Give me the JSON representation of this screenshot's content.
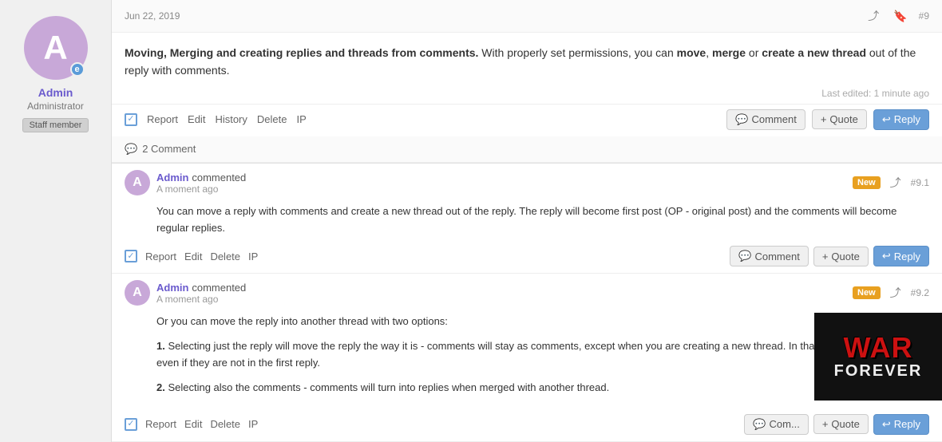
{
  "sidebar": {
    "avatar_letter": "A",
    "avatar_badge": "e",
    "username": "Admin",
    "role": "Administrator",
    "staff_label": "Staff member"
  },
  "post": {
    "date": "Jun 22, 2019",
    "post_number": "#9",
    "body_bold": "Moving, Merging and creating replies and threads from comments.",
    "body_text": " With properly set permissions, you can ",
    "bold_move": "move",
    "comma1": ", ",
    "bold_merge": "merge",
    "or_text": " or ",
    "bold_create": "create a new thread",
    "out_text": " out of the reply with comments.",
    "last_edited": "Last edited: 1 minute ago",
    "actions_left": {
      "report": "Report",
      "edit": "Edit",
      "history": "History",
      "delete": "Delete",
      "ip": "IP"
    },
    "actions_right": {
      "comment": "Comment",
      "quote": "Quote",
      "reply": "Reply"
    },
    "comments_count_label": "2 Comment"
  },
  "comments": [
    {
      "id": "comment-1",
      "avatar_letter": "A",
      "author": "Admin",
      "verb": "commented",
      "time": "A moment ago",
      "badge": "New",
      "number": "#9.1",
      "body": "You can move a reply with comments and create a new thread out of the reply. The reply will become first post (OP - original post) and the comments will become regular replies.",
      "actions_left": {
        "report": "Report",
        "edit": "Edit",
        "delete": "Delete",
        "ip": "IP"
      },
      "actions_right": {
        "comment": "Comment",
        "quote": "Quote",
        "reply": "Reply"
      }
    },
    {
      "id": "comment-2",
      "avatar_letter": "A",
      "author": "Admin",
      "verb": "commented",
      "time": "A moment ago",
      "badge": "New",
      "number": "#9.2",
      "body_intro": "Or you can move the reply into another thread with two options:",
      "list_items": [
        {
          "num": "1.",
          "text": "Selecting just the reply will move the reply the way it is - comments will stay as comments, except when you are creating a new thread. In that ca... turn into replies even if they are not in the first reply."
        },
        {
          "num": "2.",
          "text": "Selecting also the comments - comments will turn into replies when merged with another thread."
        }
      ],
      "actions_left": {
        "report": "Report",
        "edit": "Edit",
        "delete": "Delete",
        "ip": "IP"
      },
      "actions_right": {
        "comment": "Com...",
        "quote": "Quote",
        "reply": "Reply"
      }
    }
  ],
  "watermark": {
    "line1": "WAR",
    "line2": "FOREVER"
  },
  "icons": {
    "share": "⤴",
    "bookmark": "🔖",
    "comment_bubble": "💬",
    "plus": "+",
    "reply_arrow": "↩",
    "check": "✓"
  }
}
